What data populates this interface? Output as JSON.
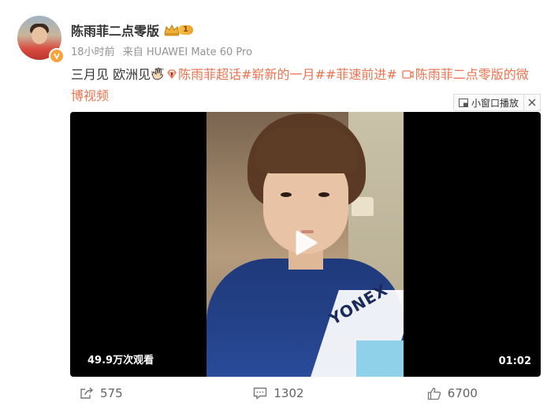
{
  "post": {
    "author": {
      "name": "陈雨菲二点零版",
      "vip_level": "1",
      "verified_icon": "verified-badge-icon",
      "avatar_icon": "avatar"
    },
    "meta": {
      "time": "18小时前",
      "source": "来自 HUAWEI Mate 60 Pro"
    },
    "content": {
      "text_plain": "三月见 欧洲见",
      "wave_icon": "waving-hand-emoji-icon",
      "topic_icon": "diamond-topic-icon",
      "topic_link": "陈雨菲超话",
      "hashtag1": "#崭新的一月#",
      "hashtag2": "#菲速前进#",
      "video_icon": "video-camera-icon",
      "video_link_line1": "陈雨菲二点零版的微",
      "video_link_line2": "博视频"
    },
    "mini_window": {
      "label": "小窗口播放"
    },
    "video": {
      "views": "49.9万次观看",
      "duration": "01:02",
      "shirt_logo": "YONEX"
    },
    "actions": {
      "repost_count": "575",
      "comment_count": "1302",
      "like_count": "6700"
    }
  }
}
